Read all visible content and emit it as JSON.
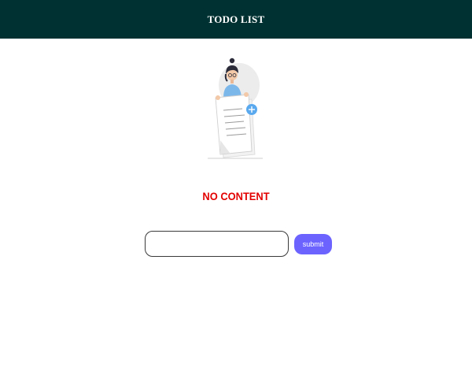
{
  "header": {
    "title": "TODO LIST"
  },
  "empty_state": {
    "illustration_icon": "person-holding-document-with-plus-icon",
    "message": "NO CONTENT"
  },
  "form": {
    "input_value": "",
    "input_placeholder": "",
    "submit_label": "submit"
  },
  "colors": {
    "header_bg": "#003132",
    "header_text": "#ffffff",
    "empty_text": "#e30000",
    "button_bg": "#6c63ff",
    "accent_blue": "#5aa9ee"
  }
}
